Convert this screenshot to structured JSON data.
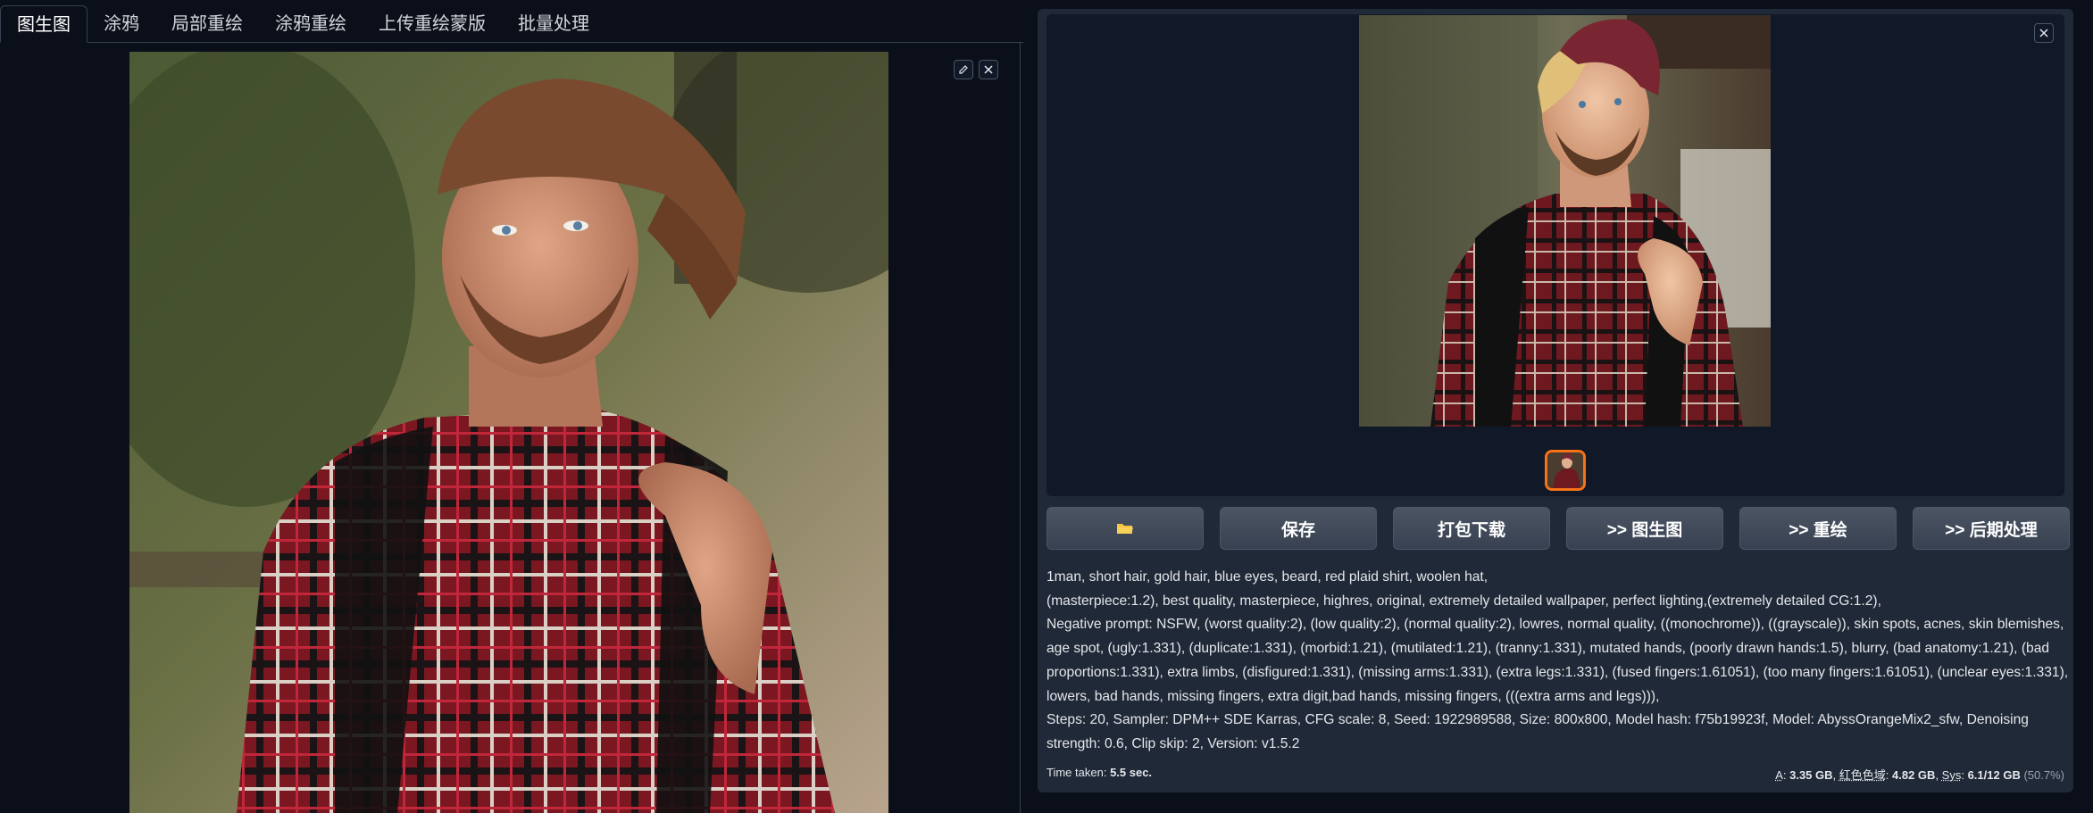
{
  "tabs": [
    {
      "label": "图生图",
      "active": true
    },
    {
      "label": "涂鸦",
      "active": false
    },
    {
      "label": "局部重绘",
      "active": false
    },
    {
      "label": "涂鸦重绘",
      "active": false
    },
    {
      "label": "上传重绘蒙版",
      "active": false
    },
    {
      "label": "批量处理",
      "active": false
    }
  ],
  "input_image": {
    "icons": [
      "pencil-icon",
      "close-icon"
    ]
  },
  "output": {
    "close_icon": "close-icon",
    "thumbnail_selected": true
  },
  "buttons": [
    {
      "label": "",
      "icon": "folder-icon"
    },
    {
      "label": "保存"
    },
    {
      "label": "打包下载"
    },
    {
      "label": ">> 图生图"
    },
    {
      "label": ">> 重绘"
    },
    {
      "label": ">> 后期处理"
    }
  ],
  "generation_info": {
    "prompt_line1": "1man, short hair, gold hair, blue eyes, beard, red plaid shirt, woolen hat,",
    "prompt_line2": "(masterpiece:1.2), best quality, masterpiece, highres, original, extremely detailed wallpaper, perfect lighting,(extremely detailed CG:1.2),",
    "negative_prompt": "Negative prompt: NSFW, (worst quality:2), (low quality:2), (normal quality:2), lowres, normal quality, ((monochrome)), ((grayscale)), skin spots, acnes, skin blemishes, age spot, (ugly:1.331), (duplicate:1.331), (morbid:1.21), (mutilated:1.21), (tranny:1.331), mutated hands, (poorly drawn hands:1.5), blurry, (bad anatomy:1.21), (bad proportions:1.331), extra limbs, (disfigured:1.331), (missing arms:1.331), (extra legs:1.331), (fused fingers:1.61051), (too many fingers:1.61051), (unclear eyes:1.331), lowers, bad hands, missing fingers, extra digit,bad hands, missing fingers, (((extra arms and legs))),",
    "params": "Steps: 20, Sampler: DPM++ SDE Karras, CFG scale: 8, Seed: 1922989588, Size: 800x800, Model hash: f75b19923f, Model: AbyssOrangeMix2_sfw, Denoising strength: 0.6, Clip skip: 2, Version: v1.5.2"
  },
  "footer": {
    "time_label": "Time taken:",
    "time_value": "5.5 sec.",
    "a_label": "A",
    "a_value": "3.35 GB",
    "red_label": "红色色域",
    "red_value": "4.82 GB",
    "sys_label": "Sys",
    "sys_value": "6.1/12 GB",
    "sys_pct": "(50.7%)"
  },
  "colors": {
    "background": "#0b0f19",
    "panel": "#1f2937",
    "button": "#374151",
    "thumb_border": "#f97316"
  }
}
